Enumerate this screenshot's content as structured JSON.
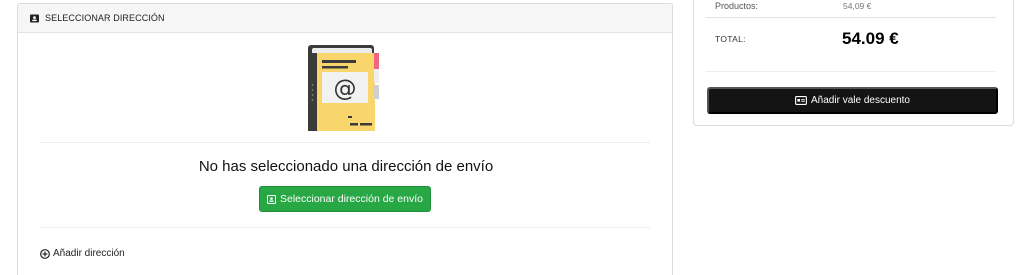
{
  "address_panel": {
    "header_title": "SELECCIONAR DIRECCIÓN",
    "header_icon": "address-card-icon",
    "illustration": "address-book-icon",
    "empty_message": "No has seleccionado una dirección de envío",
    "select_button_label": "Seleccionar dirección de envío",
    "select_button_icon": "address-card-icon",
    "add_address_label": "Añadir dirección",
    "add_address_icon": "plus-circle-icon"
  },
  "summary": {
    "products_label": "Productos:",
    "products_value": "54,09 €",
    "total_label": "TOTAL:",
    "total_value": "54.09 €",
    "voucher_button_label": "Añadir vale descuento",
    "voucher_button_icon": "voucher-icon"
  },
  "colors": {
    "primary_green": "#28a745",
    "dark_button": "#141414",
    "book_yellow": "#f9d66b",
    "book_cover": "#3b3b3b",
    "tab_pink": "#f06581"
  }
}
